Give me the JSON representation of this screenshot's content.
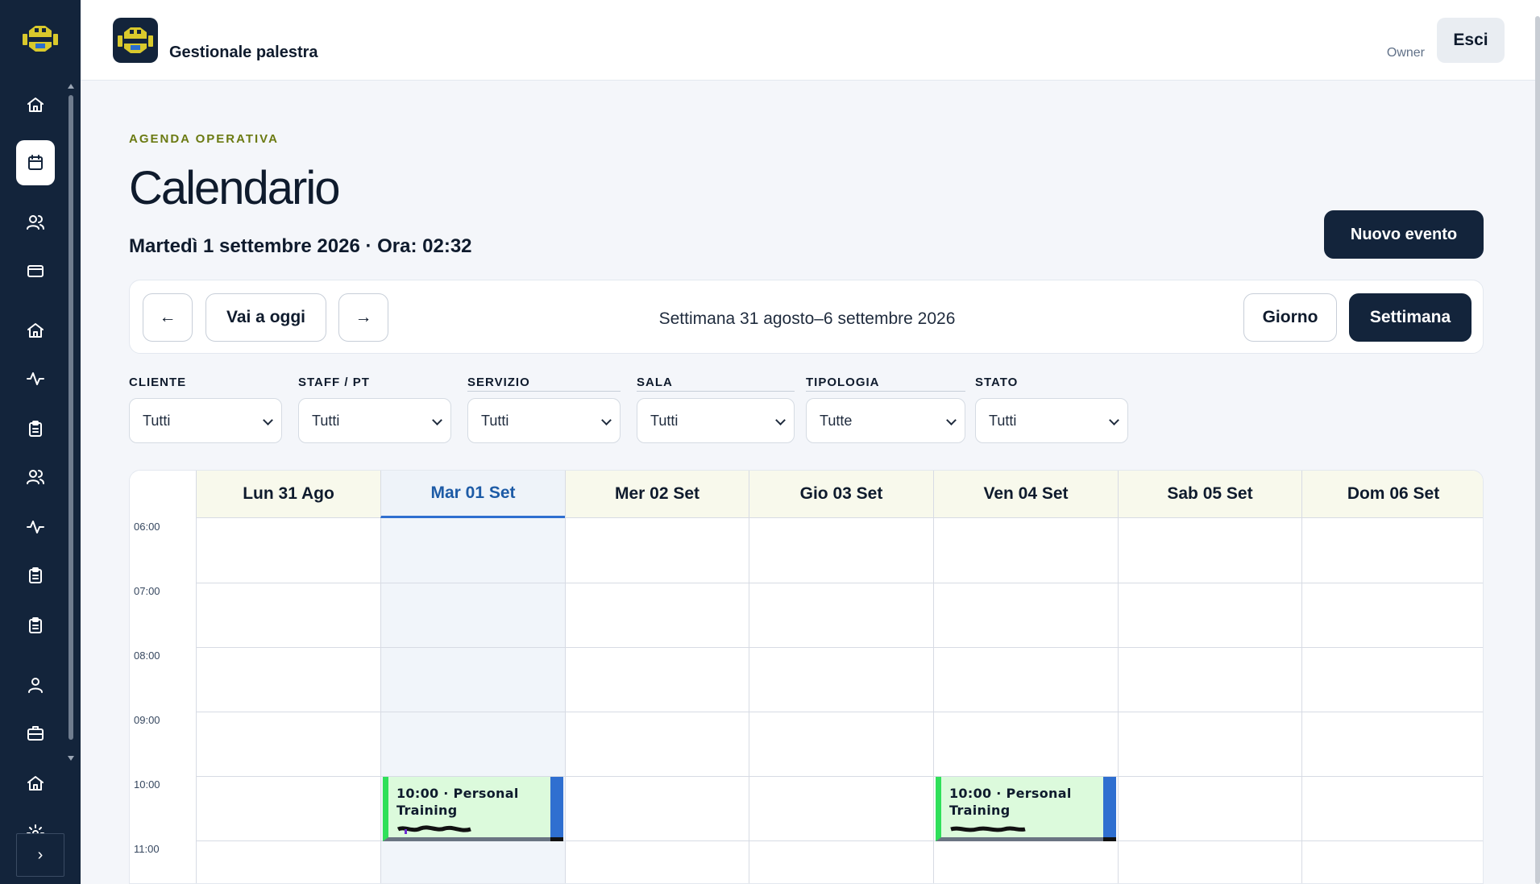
{
  "app": {
    "title": "Gestionale palestra",
    "role": "Owner",
    "logout_label": "Esci",
    "brand_color": "#13243b",
    "accent_color": "#6b7a12"
  },
  "sidebar": {
    "items": [
      {
        "icon": "home-icon",
        "active": false
      },
      {
        "icon": "calendar-icon",
        "active": true
      },
      {
        "icon": "users-icon",
        "active": false
      },
      {
        "icon": "credit-card-icon",
        "active": false
      },
      {
        "icon": "home-icon",
        "active": false
      },
      {
        "icon": "activity-icon",
        "active": false
      },
      {
        "icon": "clipboard-icon",
        "active": false
      },
      {
        "icon": "users-icon",
        "active": false
      },
      {
        "icon": "activity-icon",
        "active": false
      },
      {
        "icon": "clipboard-icon",
        "active": false
      },
      {
        "icon": "clipboard-icon",
        "active": false
      },
      {
        "icon": "user-icon",
        "active": false
      },
      {
        "icon": "briefcase-icon",
        "active": false
      },
      {
        "icon": "home-icon",
        "active": false
      },
      {
        "icon": "settings-icon",
        "active": false
      }
    ],
    "expand_label": "›"
  },
  "page": {
    "eyebrow": "AGENDA OPERATIVA",
    "title": "Calendario",
    "date_line": "Martedì 1 settembre 2026 · Ora: 02:32",
    "new_event_label": "Nuovo evento"
  },
  "nav": {
    "prev_label": "←",
    "today_label": "Vai a oggi",
    "next_label": "→",
    "week_label": "Settimana 31 agosto–6 settembre 2026",
    "view_day_label": "Giorno",
    "view_week_label": "Settimana",
    "active_view": "Settimana"
  },
  "filters": [
    {
      "label": "CLIENTE",
      "value": "Tutti"
    },
    {
      "label": "STAFF / PT",
      "value": "Tutti"
    },
    {
      "label": "SERVIZIO",
      "value": "Tutti"
    },
    {
      "label": "SALA",
      "value": "Tutti"
    },
    {
      "label": "TIPOLOGIA",
      "value": "Tutte"
    },
    {
      "label": "STATO",
      "value": "Tutti"
    }
  ],
  "calendar": {
    "days": [
      "Lun 31 Ago",
      "Mar 01 Set",
      "Mer 02 Set",
      "Gio 03 Set",
      "Ven 04 Set",
      "Sab 05 Set",
      "Dom 06 Set"
    ],
    "today_index": 1,
    "hours": [
      "06:00",
      "07:00",
      "08:00",
      "09:00",
      "10:00",
      "11:00"
    ],
    "events": [
      {
        "day_index": 1,
        "start": "10:00",
        "title": "10:00 · Personal Training"
      },
      {
        "day_index": 4,
        "start": "10:00",
        "title": "10:00 · Personal Training"
      }
    ],
    "event_colors": {
      "bg": "#dcfadc",
      "left": "#2fe05a",
      "right": "#2f6fd0"
    }
  }
}
